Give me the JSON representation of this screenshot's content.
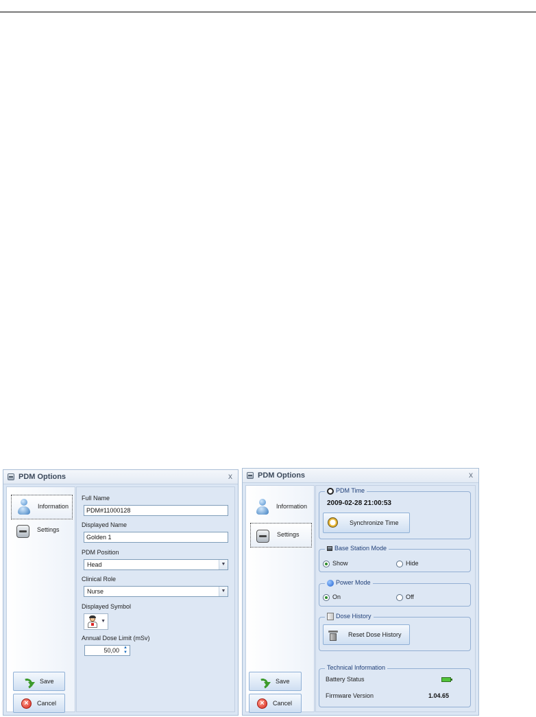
{
  "left_window": {
    "title": "PDM Options",
    "close_glyph": "x",
    "nav": [
      {
        "label": "Information",
        "icon": "person-icon",
        "selected": true
      },
      {
        "label": "Settings",
        "icon": "device-icon",
        "selected": false
      }
    ],
    "buttons": {
      "save_label": "Save",
      "cancel_label": "Cancel"
    },
    "form": {
      "full_name_label": "Full Name",
      "full_name_value": "PDM#11000128",
      "displayed_name_label": "Displayed Name",
      "displayed_name_value": "Golden 1",
      "pdm_position_label": "PDM Position",
      "pdm_position_value": "Head",
      "clinical_role_label": "Clinical Role",
      "clinical_role_value": "Nurse",
      "displayed_symbol_label": "Displayed Symbol",
      "displayed_symbol_icon": "nurse-symbol-icon",
      "annual_dose_label": "Annual Dose Limit (mSv)",
      "annual_dose_value": "50,00"
    }
  },
  "right_window": {
    "title": "PDM Options",
    "close_glyph": "x",
    "nav": [
      {
        "label": "Information",
        "icon": "person-icon",
        "selected": false
      },
      {
        "label": "Settings",
        "icon": "device-icon",
        "selected": true
      }
    ],
    "buttons": {
      "save_label": "Save",
      "cancel_label": "Cancel"
    },
    "pdm_time": {
      "title": "PDM Time",
      "datetime": "2009-02-28 21:00:53",
      "sync_label": "Synchronize Time"
    },
    "base_station_mode": {
      "title": "Base Station Mode",
      "options": [
        "Show",
        "Hide"
      ],
      "selected": "Show"
    },
    "power_mode": {
      "title": "Power Mode",
      "options": [
        "On",
        "Off"
      ],
      "selected": "On"
    },
    "dose_history": {
      "title": "Dose History",
      "reset_label": "Reset Dose History"
    },
    "technical_information": {
      "title": "Technical Information",
      "battery_label": "Battery Status",
      "battery_color": "#52c43a",
      "firmware_label": "Firmware Version",
      "firmware_value": "1.04.65"
    }
  }
}
